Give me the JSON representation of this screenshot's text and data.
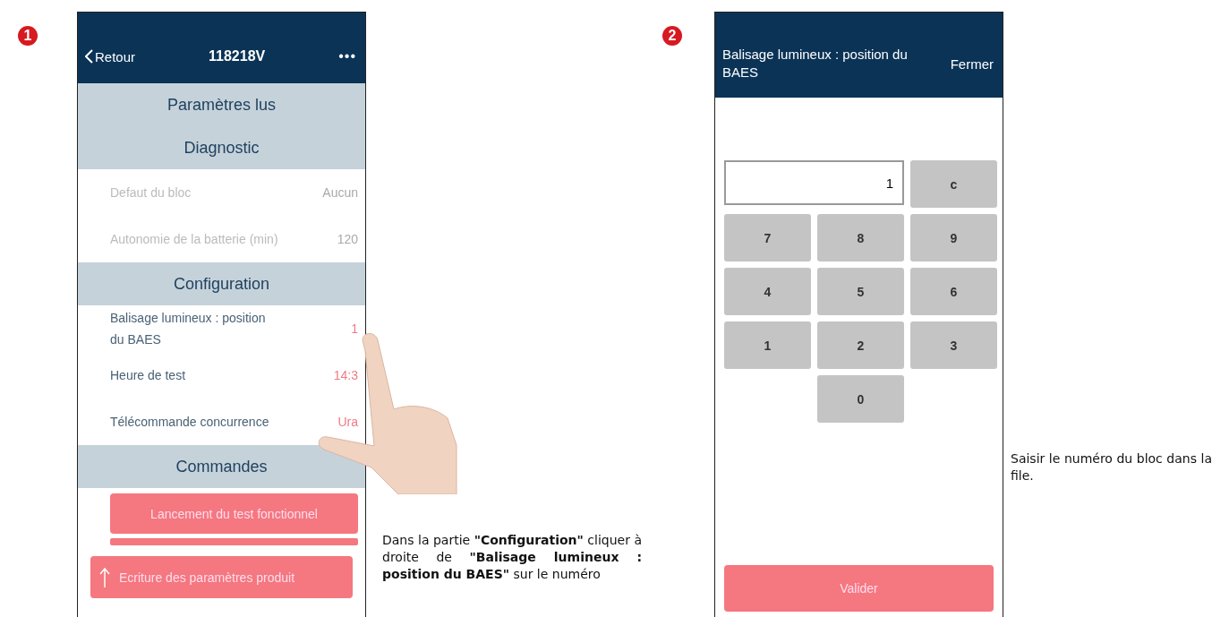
{
  "steps": [
    {
      "number": "1",
      "kind": "list",
      "header": {
        "back": "Retour",
        "title": "118218V",
        "more": "•••"
      },
      "sections": [
        {
          "title": "Paramètres lus"
        },
        {
          "title": "Diagnostic",
          "rows": [
            {
              "label": "Defaut du bloc",
              "value": "Aucun",
              "disabled": true
            },
            {
              "label": "Autonomie de la batterie (min)",
              "value": "120",
              "disabled": true
            }
          ]
        },
        {
          "title": "Configuration",
          "rows": [
            {
              "label": "Balisage lumineux : position du BAES",
              "value": "1",
              "disabled": false
            },
            {
              "label": "Heure de test",
              "value": "14:3",
              "disabled": false
            },
            {
              "label": "Télécommande concurrence",
              "value": "Ura",
              "disabled": false
            }
          ]
        },
        {
          "title": "Commandes"
        }
      ],
      "buttons": [
        "Lancement du test fonctionnel"
      ],
      "footer_button": "Ecriture des paramètres produit",
      "caption": "Dans la partie **\"Configuration\"** cliquer à droite de **\"Balisage lumineux : position du BAES\"** sur le numéro"
    },
    {
      "number": "2",
      "kind": "keypad",
      "header": {
        "title": "Balisage lumineux : position du BAES",
        "close": "Fermer"
      },
      "input": {
        "value": "1"
      },
      "clear": "c",
      "keys": [
        [
          "7",
          "8",
          "9"
        ],
        [
          "4",
          "5",
          "6"
        ],
        [
          "1",
          "2",
          "3"
        ],
        [
          "0"
        ]
      ],
      "submit": "Valider",
      "caption": "Saisir le numéro du bloc dans la file."
    }
  ]
}
